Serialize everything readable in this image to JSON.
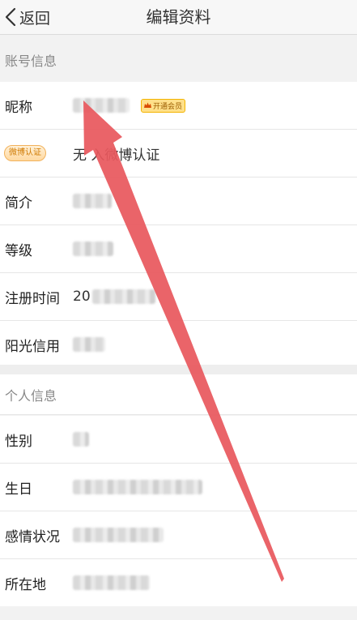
{
  "nav": {
    "back_label": "返回",
    "title": "编辑资料"
  },
  "account_section": {
    "header": "账号信息",
    "nickname_label": "昵称",
    "vip_label": "开通会员",
    "weibo_badge": "微博认证",
    "weibo_text": "无   入微博认证",
    "intro_label": "简介",
    "level_label": "等级",
    "register_label": "注册时间",
    "register_prefix": "20",
    "credit_label": "阳光信用"
  },
  "personal_section": {
    "header": "个人信息",
    "gender_label": "性别",
    "birthday_label": "生日",
    "relationship_label": "感情状况",
    "location_label": "所在地"
  },
  "colors": {
    "arrow": "#e8585e",
    "vip_bg": "#ffe08a",
    "badge_text": "#d07a00"
  }
}
